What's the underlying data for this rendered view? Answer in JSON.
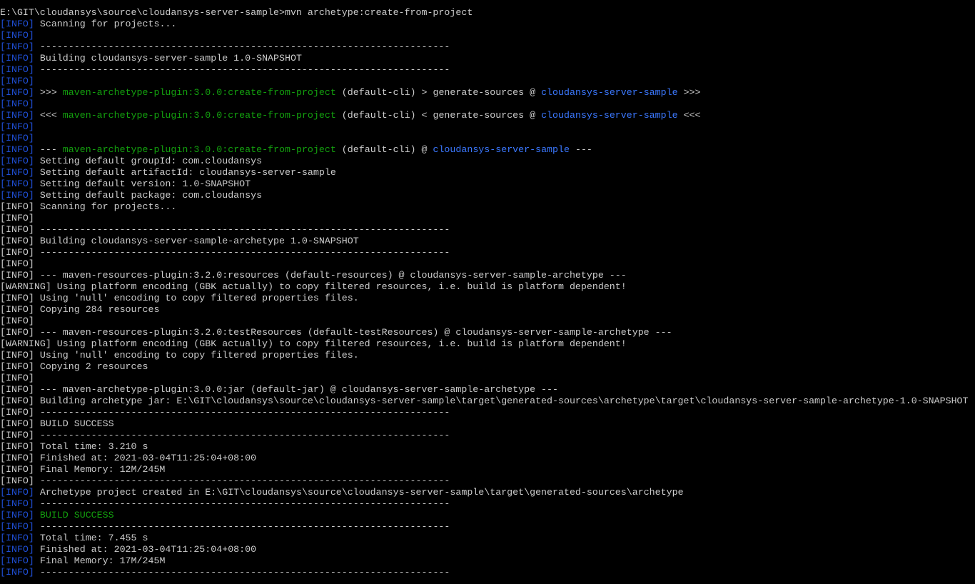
{
  "colors": {
    "background": "#000000",
    "text": "#cccccc",
    "info_tag": "#1f4fd6",
    "plugin": "#13a10e",
    "project": "#3b78ff",
    "success": "#13a10e"
  },
  "lines": [
    [
      {
        "t": "E:\\GIT\\cloudansys\\source\\cloudansys-server-sample>mvn archetype:create-from-project",
        "c": "white"
      }
    ],
    [
      {
        "t": "[",
        "c": "blue-dark"
      },
      {
        "t": "INFO",
        "c": "blue-dark"
      },
      {
        "t": "]",
        "c": "blue-dark"
      },
      {
        "t": " Scanning for projects...",
        "c": "white"
      }
    ],
    [
      {
        "t": "[INFO]",
        "c": "blue-dark"
      }
    ],
    [
      {
        "t": "[INFO]",
        "c": "blue-dark"
      },
      {
        "t": " ------------------------------------------------------------------------",
        "c": "white"
      }
    ],
    [
      {
        "t": "[INFO]",
        "c": "blue-dark"
      },
      {
        "t": " Building cloudansys-server-sample 1.0-SNAPSHOT",
        "c": "white"
      }
    ],
    [
      {
        "t": "[INFO]",
        "c": "blue-dark"
      },
      {
        "t": " ------------------------------------------------------------------------",
        "c": "white"
      }
    ],
    [
      {
        "t": "[INFO]",
        "c": "blue-dark"
      }
    ],
    [
      {
        "t": "[INFO]",
        "c": "blue-dark"
      },
      {
        "t": " >>> ",
        "c": "white"
      },
      {
        "t": "maven-archetype-plugin:3.0.0:create-from-project",
        "c": "green"
      },
      {
        "t": " (default-cli) > generate-sources @ ",
        "c": "white"
      },
      {
        "t": "cloudansys-server-sample",
        "c": "blue"
      },
      {
        "t": " >>>",
        "c": "white"
      }
    ],
    [
      {
        "t": "[INFO]",
        "c": "blue-dark"
      }
    ],
    [
      {
        "t": "[INFO]",
        "c": "blue-dark"
      },
      {
        "t": " <<< ",
        "c": "white"
      },
      {
        "t": "maven-archetype-plugin:3.0.0:create-from-project",
        "c": "green"
      },
      {
        "t": " (default-cli) < generate-sources @ ",
        "c": "white"
      },
      {
        "t": "cloudansys-server-sample",
        "c": "blue"
      },
      {
        "t": " <<<",
        "c": "white"
      }
    ],
    [
      {
        "t": "[INFO]",
        "c": "blue-dark"
      }
    ],
    [
      {
        "t": "[INFO]",
        "c": "blue-dark"
      }
    ],
    [
      {
        "t": "[INFO]",
        "c": "blue-dark"
      },
      {
        "t": " --- ",
        "c": "white"
      },
      {
        "t": "maven-archetype-plugin:3.0.0:create-from-project",
        "c": "green"
      },
      {
        "t": " (default-cli) @ ",
        "c": "white"
      },
      {
        "t": "cloudansys-server-sample",
        "c": "blue"
      },
      {
        "t": " ---",
        "c": "white"
      }
    ],
    [
      {
        "t": "[INFO]",
        "c": "blue-dark"
      },
      {
        "t": " Setting default groupId: com.cloudansys",
        "c": "white"
      }
    ],
    [
      {
        "t": "[INFO]",
        "c": "blue-dark"
      },
      {
        "t": " Setting default artifactId: cloudansys-server-sample",
        "c": "white"
      }
    ],
    [
      {
        "t": "[INFO]",
        "c": "blue-dark"
      },
      {
        "t": " Setting default version: 1.0-SNAPSHOT",
        "c": "white"
      }
    ],
    [
      {
        "t": "[INFO]",
        "c": "blue-dark"
      },
      {
        "t": " Setting default package: com.cloudansys",
        "c": "white"
      }
    ],
    [
      {
        "t": "[INFO] Scanning for projects...",
        "c": "white"
      }
    ],
    [
      {
        "t": "[INFO]",
        "c": "white"
      }
    ],
    [
      {
        "t": "[INFO] ------------------------------------------------------------------------",
        "c": "white"
      }
    ],
    [
      {
        "t": "[INFO] Building cloudansys-server-sample-archetype 1.0-SNAPSHOT",
        "c": "white"
      }
    ],
    [
      {
        "t": "[INFO] ------------------------------------------------------------------------",
        "c": "white"
      }
    ],
    [
      {
        "t": "[INFO]",
        "c": "white"
      }
    ],
    [
      {
        "t": "[INFO] --- maven-resources-plugin:3.2.0:resources (default-resources) @ cloudansys-server-sample-archetype ---",
        "c": "white"
      }
    ],
    [
      {
        "t": "[WARNING] Using platform encoding (GBK actually) to copy filtered resources, i.e. build is platform dependent!",
        "c": "white"
      }
    ],
    [
      {
        "t": "[INFO] Using 'null' encoding to copy filtered properties files.",
        "c": "white"
      }
    ],
    [
      {
        "t": "[INFO] Copying 284 resources",
        "c": "white"
      }
    ],
    [
      {
        "t": "[INFO]",
        "c": "white"
      }
    ],
    [
      {
        "t": "[INFO] --- maven-resources-plugin:3.2.0:testResources (default-testResources) @ cloudansys-server-sample-archetype ---",
        "c": "white"
      }
    ],
    [
      {
        "t": "[WARNING] Using platform encoding (GBK actually) to copy filtered resources, i.e. build is platform dependent!",
        "c": "white"
      }
    ],
    [
      {
        "t": "[INFO] Using 'null' encoding to copy filtered properties files.",
        "c": "white"
      }
    ],
    [
      {
        "t": "[INFO] Copying 2 resources",
        "c": "white"
      }
    ],
    [
      {
        "t": "[INFO]",
        "c": "white"
      }
    ],
    [
      {
        "t": "[INFO] --- maven-archetype-plugin:3.0.0:jar (default-jar) @ cloudansys-server-sample-archetype ---",
        "c": "white"
      }
    ],
    [
      {
        "t": "[INFO] Building archetype jar: E:\\GIT\\cloudansys\\source\\cloudansys-server-sample\\target\\generated-sources\\archetype\\target\\cloudansys-server-sample-archetype-1.0-SNAPSHOT",
        "c": "white"
      }
    ],
    [
      {
        "t": "[INFO] ------------------------------------------------------------------------",
        "c": "white"
      }
    ],
    [
      {
        "t": "[INFO] BUILD SUCCESS",
        "c": "white"
      }
    ],
    [
      {
        "t": "[INFO] ------------------------------------------------------------------------",
        "c": "white"
      }
    ],
    [
      {
        "t": "[INFO] Total time: 3.210 s",
        "c": "white"
      }
    ],
    [
      {
        "t": "[INFO] Finished at: 2021-03-04T11:25:04+08:00",
        "c": "white"
      }
    ],
    [
      {
        "t": "[INFO] Final Memory: 12M/245M",
        "c": "white"
      }
    ],
    [
      {
        "t": "[INFO] ------------------------------------------------------------------------",
        "c": "white"
      }
    ],
    [
      {
        "t": "[INFO]",
        "c": "blue-dark"
      },
      {
        "t": " Archetype project created in E:\\GIT\\cloudansys\\source\\cloudansys-server-sample\\target\\generated-sources\\archetype",
        "c": "white"
      }
    ],
    [
      {
        "t": "[INFO]",
        "c": "blue-dark"
      },
      {
        "t": " ------------------------------------------------------------------------",
        "c": "white"
      }
    ],
    [
      {
        "t": "[INFO]",
        "c": "blue-dark"
      },
      {
        "t": " BUILD SUCCESS",
        "c": "green"
      }
    ],
    [
      {
        "t": "[INFO]",
        "c": "blue-dark"
      },
      {
        "t": " ------------------------------------------------------------------------",
        "c": "white"
      }
    ],
    [
      {
        "t": "[INFO]",
        "c": "blue-dark"
      },
      {
        "t": " Total time: 7.455 s",
        "c": "white"
      }
    ],
    [
      {
        "t": "[INFO]",
        "c": "blue-dark"
      },
      {
        "t": " Finished at: 2021-03-04T11:25:04+08:00",
        "c": "white"
      }
    ],
    [
      {
        "t": "[INFO]",
        "c": "blue-dark"
      },
      {
        "t": " Final Memory: 17M/245M",
        "c": "white"
      }
    ],
    [
      {
        "t": "[INFO]",
        "c": "blue-dark"
      },
      {
        "t": " ------------------------------------------------------------------------",
        "c": "white"
      }
    ]
  ]
}
